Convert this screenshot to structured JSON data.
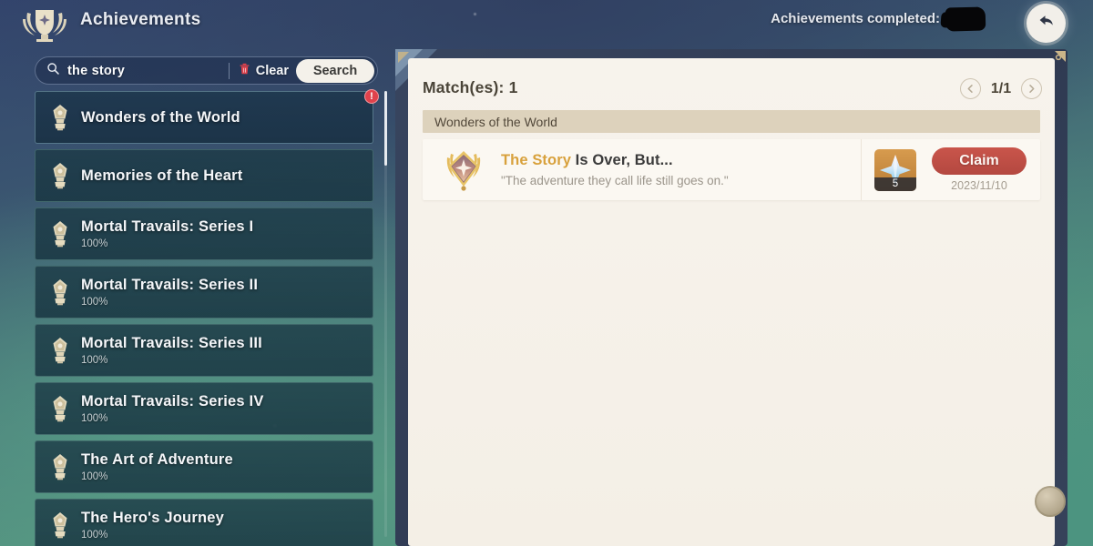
{
  "header": {
    "logo_icon": "achievement-trophy-laurel-icon",
    "title": "Achievements",
    "completed_label": "Achievements completed:",
    "completed_value_redacted": true,
    "back_icon": "back-arrow-icon"
  },
  "search": {
    "icon": "search-icon",
    "value": "the story",
    "placeholder": "Search",
    "clear_icon": "trash-icon",
    "clear_label": "Clear",
    "search_label": "Search"
  },
  "sidebar": {
    "items": [
      {
        "name": "Wonders of the World",
        "progress": "",
        "icon": "achievement-medal-icon",
        "selected": true,
        "alert": true
      },
      {
        "name": "Memories of the Heart",
        "progress": "",
        "icon": "achievement-medal-icon",
        "selected": false,
        "alert": false
      },
      {
        "name": "Mortal Travails: Series I",
        "progress": "100%",
        "icon": "achievement-medal-icon",
        "selected": false,
        "alert": false
      },
      {
        "name": "Mortal Travails: Series II",
        "progress": "100%",
        "icon": "achievement-medal-icon",
        "selected": false,
        "alert": false
      },
      {
        "name": "Mortal Travails: Series III",
        "progress": "100%",
        "icon": "achievement-medal-icon",
        "selected": false,
        "alert": false
      },
      {
        "name": "Mortal Travails: Series IV",
        "progress": "100%",
        "icon": "achievement-medal-icon",
        "selected": false,
        "alert": false
      },
      {
        "name": "The Art of Adventure",
        "progress": "100%",
        "icon": "achievement-medal-icon",
        "selected": false,
        "alert": false
      },
      {
        "name": "The Hero's Journey",
        "progress": "100%",
        "icon": "achievement-medal-icon",
        "selected": false,
        "alert": false
      }
    ],
    "alert_badge_text": "!"
  },
  "panel": {
    "match_count_label": "Match(es): 1",
    "pagination": {
      "prev_icon": "chevron-left-icon",
      "next_icon": "chevron-right-icon",
      "indicator": "1/1"
    },
    "group_header": "Wonders of the World",
    "achievement": {
      "badge_icon": "achievement-rank-badge-icon",
      "title_match": "The Story",
      "title_rest": " Is Over, But...",
      "description": "\"The adventure they call life still goes on.\"",
      "reward": {
        "icon": "primogem-icon",
        "count": "5"
      },
      "claim_label": "Claim",
      "claim_date": "2023/11/10"
    },
    "side_ornament_icon": "circular-ornament-icon"
  },
  "colors": {
    "accent_gold": "#d8a13c",
    "claim_red": "#c9554b",
    "panel_cream": "#f7f3ec",
    "group_band": "#ddd2bc",
    "alert_red": "#e0424c"
  }
}
